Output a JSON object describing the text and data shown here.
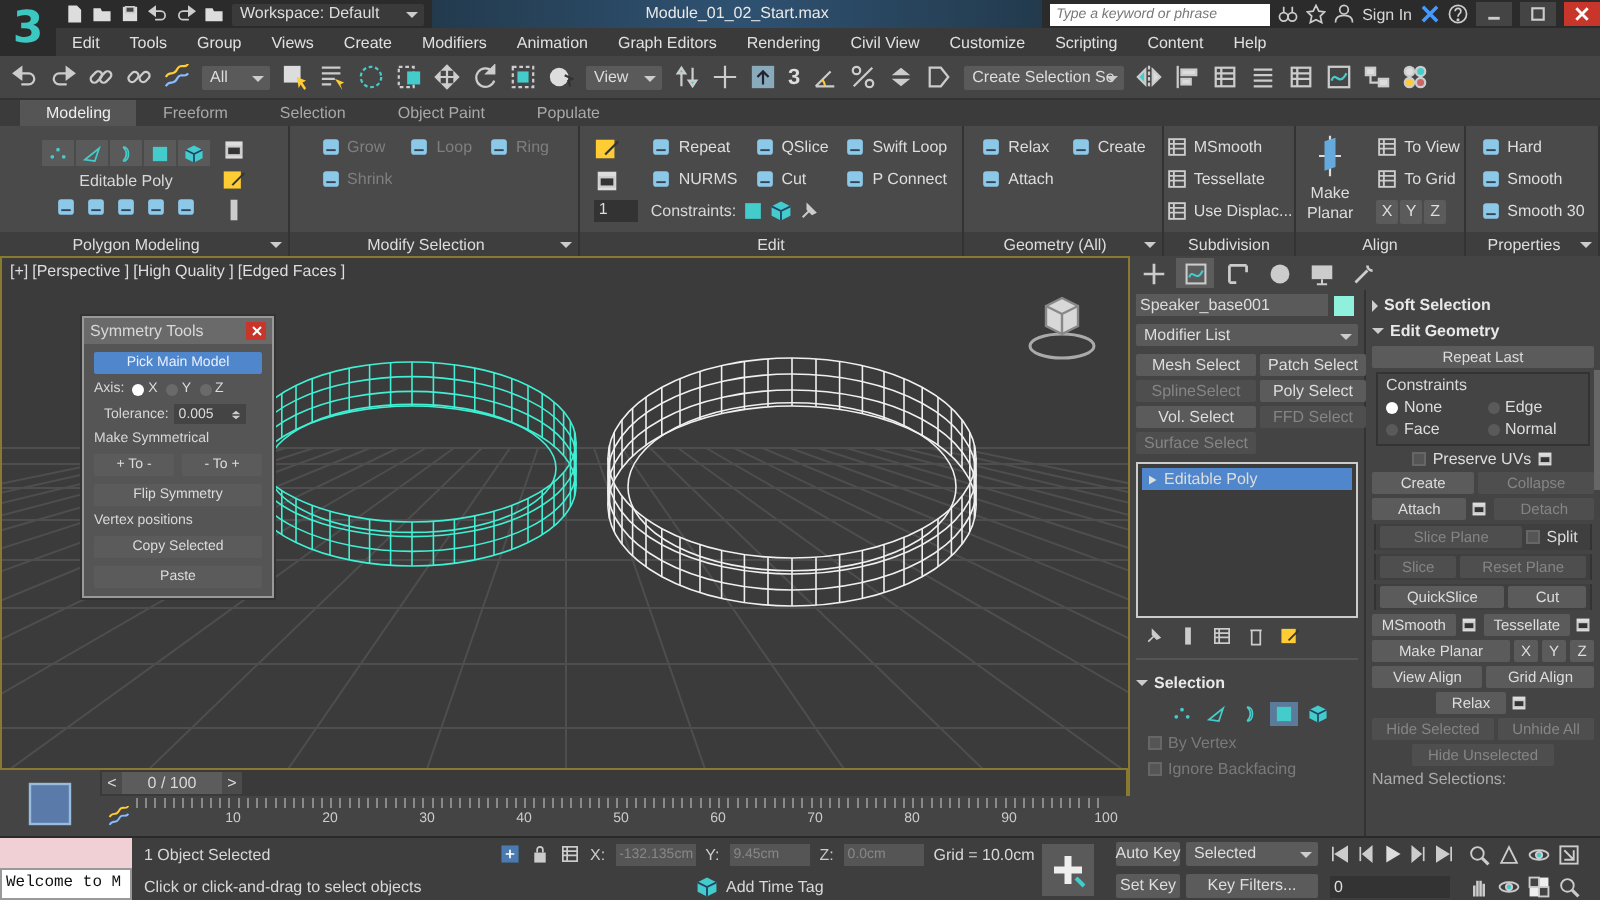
{
  "title_bar": {
    "logo": "3",
    "workspace": "Workspace: Default",
    "file_name": "Module_01_02_Start.max",
    "search": {
      "placeholder": "Type a keyword or phrase"
    },
    "sign_in": "Sign In"
  },
  "menu_bar": [
    "Edit",
    "Tools",
    "Group",
    "Views",
    "Create",
    "Modifiers",
    "Animation",
    "Graph Editors",
    "Rendering",
    "Civil View",
    "Customize",
    "Scripting",
    "Content",
    "Help"
  ],
  "toolbar": {
    "selection_filter": "All",
    "reference_coordinate": "View",
    "snap_label": "3",
    "named_selection": "Create Selection Se"
  },
  "ribbon": {
    "tabs": [
      {
        "label": "Modeling",
        "selected": true
      },
      {
        "label": "Freeform",
        "selected": false
      },
      {
        "label": "Selection",
        "selected": false
      },
      {
        "label": "Object Paint",
        "selected": false
      },
      {
        "label": "Populate",
        "selected": false
      }
    ],
    "groups": [
      {
        "kind": "polygon",
        "title": "Polygon Modeling",
        "dropdown": true,
        "label": "Editable Poly"
      },
      {
        "kind": "modify",
        "title": "Modify Selection",
        "dropdown": true,
        "items": [
          {
            "kind": "button",
            "label": "Grow",
            "disabled": true
          },
          {
            "kind": "button",
            "label": "Loop",
            "disabled": true
          },
          {
            "kind": "button",
            "label": "Ring",
            "disabled": true
          },
          {
            "kind": "button",
            "label": "Shrink",
            "disabled": true
          }
        ]
      },
      {
        "kind": "edit",
        "title": "Edit",
        "dropdown": false,
        "spinner": "1",
        "items": [
          {
            "kind": "button",
            "label": "Repeat",
            "disabled": false
          },
          {
            "kind": "button",
            "label": "QSlice",
            "disabled": false
          },
          {
            "kind": "button",
            "label": "Swift Loop",
            "disabled": false
          },
          {
            "kind": "button",
            "label": "NURMS",
            "disabled": false
          },
          {
            "kind": "button",
            "label": "Cut",
            "disabled": false
          },
          {
            "kind": "button",
            "label": "P Connect",
            "disabled": false
          },
          {
            "kind": "constraints",
            "label": "Constraints:"
          }
        ]
      },
      {
        "kind": "geometry",
        "title": "Geometry (All)",
        "dropdown": true,
        "items": [
          {
            "kind": "button",
            "label": "Relax",
            "disabled": false
          },
          {
            "kind": "button",
            "label": "Create",
            "disabled": false
          },
          {
            "kind": "button",
            "label": "Attach",
            "disabled": false
          }
        ]
      },
      {
        "kind": "subdivision",
        "title": "Subdivision",
        "dropdown": false,
        "items": [
          {
            "kind": "button",
            "label": "MSmooth",
            "disabled": false
          },
          {
            "kind": "button",
            "label": "Tessellate",
            "disabled": false
          },
          {
            "kind": "button",
            "label": "Use Displac...",
            "disabled": false
          }
        ]
      },
      {
        "kind": "align",
        "title": "Align",
        "dropdown": false,
        "items": [
          {
            "kind": "big",
            "label": "Make Planar"
          },
          {
            "kind": "button",
            "label": "To View",
            "disabled": false
          },
          {
            "kind": "button",
            "label": "To Grid",
            "disabled": false
          },
          {
            "kind": "axes",
            "labels": [
              "X",
              "Y",
              "Z"
            ]
          }
        ]
      },
      {
        "kind": "properties",
        "title": "Properties",
        "dropdown": true,
        "items": [
          {
            "kind": "button",
            "label": "Hard",
            "disabled": false
          },
          {
            "kind": "button",
            "label": "Smooth",
            "disabled": false
          },
          {
            "kind": "button",
            "label": "Smooth 30",
            "disabled": false
          }
        ]
      }
    ]
  },
  "viewport": {
    "labels": [
      "[+]",
      "[Perspective ]",
      "[High Quality ]",
      "[Edged Faces ]"
    ]
  },
  "symmetry_tools": {
    "title": "Symmetry Tools",
    "pick_button": "Pick Main Model",
    "axis_label": "Axis:",
    "axes": [
      {
        "label": "X",
        "selected": true
      },
      {
        "label": "Y",
        "selected": false
      },
      {
        "label": "Z",
        "selected": false
      }
    ],
    "tolerance_label": "Tolerance:",
    "tolerance": "0.005",
    "make_symmetrical": "Make Symmetrical",
    "to_buttons": [
      "+ To -",
      "- To +"
    ],
    "flip_button": "Flip Symmetry",
    "vertex_positions": "Vertex positions",
    "copy_button": "Copy Selected",
    "paste_button": "Paste"
  },
  "timeline": {
    "prev": "<",
    "position": "0 / 100",
    "next": ">",
    "level": 0,
    "ticks": [
      "10",
      "20",
      "30",
      "40",
      "50",
      "60",
      "70",
      "80",
      "90",
      "100"
    ]
  },
  "command_panel": {
    "tabs": [
      {
        "selected": false
      },
      {
        "selected": true
      },
      {
        "selected": false
      },
      {
        "selected": false
      },
      {
        "selected": false
      },
      {
        "selected": false
      }
    ],
    "object": {
      "name": "Speaker_base001",
      "color": "#8ff0dc"
    },
    "modifier_list": "Modifier List",
    "modifier_buttons": [
      {
        "label": "Mesh Select",
        "disabled": false
      },
      {
        "label": "Patch Select",
        "disabled": false
      },
      {
        "label": "SplineSelect",
        "disabled": true
      },
      {
        "label": "Poly Select",
        "disabled": false
      },
      {
        "label": "Vol. Select",
        "disabled": false
      },
      {
        "label": "FFD Select",
        "disabled": true
      },
      {
        "label": "Surface Select",
        "disabled": true
      }
    ],
    "stack": [
      {
        "label": "Editable Poly",
        "selected": true
      }
    ],
    "selection": {
      "title": "Selection",
      "levels": [
        {
          "selected": false
        },
        {
          "selected": false
        },
        {
          "selected": false
        },
        {
          "selected": true
        },
        {
          "selected": false
        }
      ],
      "options": [
        {
          "label": "By Vertex",
          "checked": false,
          "disabled": true
        },
        {
          "label": "Ignore Backfacing",
          "checked": false,
          "disabled": true
        }
      ]
    },
    "rollouts": [
      {
        "title": "Soft Selection",
        "expanded": false
      },
      {
        "title": "Edit Geometry",
        "expanded": true
      }
    ],
    "edit_geometry": {
      "repeat_last": "Repeat Last",
      "constraints_title": "Constraints",
      "constraints": [
        {
          "label": "None",
          "selected": true
        },
        {
          "label": "Edge",
          "selected": false
        },
        {
          "label": "Face",
          "selected": false
        },
        {
          "label": "Normal",
          "selected": false
        }
      ],
      "preserve_uvs": {
        "label": "Preserve UVs",
        "checked": false
      },
      "rows": [
        {
          "boxed": false,
          "items": [
            {
              "kind": "button",
              "label": "Create",
              "disabled": false
            },
            {
              "kind": "button",
              "label": "Collapse",
              "disabled": true
            }
          ]
        },
        {
          "boxed": false,
          "items": [
            {
              "kind": "button",
              "label": "Attach",
              "disabled": false,
              "settings": true
            },
            {
              "kind": "button",
              "label": "Detach",
              "disabled": true
            }
          ]
        },
        {
          "boxed": true,
          "items": [
            {
              "kind": "button",
              "label": "Slice Plane",
              "disabled": true
            },
            {
              "kind": "checkbox",
              "label": "Split",
              "checked": false
            }
          ]
        },
        {
          "boxed": true,
          "items": [
            {
              "kind": "button",
              "label": "Slice",
              "disabled": true
            },
            {
              "kind": "button",
              "label": "Reset Plane",
              "disabled": true
            }
          ]
        },
        {
          "boxed": true,
          "items": [
            {
              "kind": "button",
              "label": "QuickSlice",
              "disabled": false
            },
            {
              "kind": "button",
              "label": "Cut",
              "disabled": false
            }
          ]
        },
        {
          "boxed": false,
          "items": [
            {
              "kind": "button",
              "label": "MSmooth",
              "disabled": false,
              "settings": true
            },
            {
              "kind": "button",
              "label": "Tessellate",
              "disabled": false,
              "settings": true
            }
          ]
        },
        {
          "boxed": false,
          "items": [
            {
              "kind": "button",
              "label": "Make Planar",
              "disabled": false
            },
            {
              "kind": "axis",
              "label": "X"
            },
            {
              "kind": "axis",
              "label": "Y"
            },
            {
              "kind": "axis",
              "label": "Z"
            }
          ]
        },
        {
          "boxed": false,
          "items": [
            {
              "kind": "button",
              "label": "View Align",
              "disabled": false
            },
            {
              "kind": "button",
              "label": "Grid Align",
              "disabled": false
            }
          ]
        },
        {
          "boxed": false,
          "items": [
            {
              "kind": "button",
              "label": "Relax",
              "disabled": false,
              "settings": true
            }
          ]
        },
        {
          "boxed": false,
          "items": [
            {
              "kind": "button",
              "label": "Hide Selected",
              "disabled": true
            },
            {
              "kind": "button",
              "label": "Unhide All",
              "disabled": true
            }
          ]
        },
        {
          "boxed": false,
          "items": [
            {
              "kind": "button",
              "label": "Hide Unselected",
              "disabled": true
            }
          ]
        },
        {
          "boxed": false,
          "items": [
            {
              "kind": "label",
              "label": "Named Selections:"
            }
          ]
        }
      ]
    }
  },
  "status_bar": {
    "listener": "Welcome to M",
    "selection_info": "1 Object Selected",
    "prompt": "Click or click-and-drag to select objects",
    "coords": [
      {
        "axis": "X:",
        "value": "-132.135cm"
      },
      {
        "axis": "Y:",
        "value": "9.45cm"
      },
      {
        "axis": "Z:",
        "value": "0.0cm"
      }
    ],
    "grid": "Grid = 10.0cm",
    "time_tag": "Add Time Tag",
    "auto_key": "Auto Key",
    "set_key": "Set Key",
    "key_mode": "Selected",
    "key_filters": "Key Filters...",
    "frame": "0"
  }
}
